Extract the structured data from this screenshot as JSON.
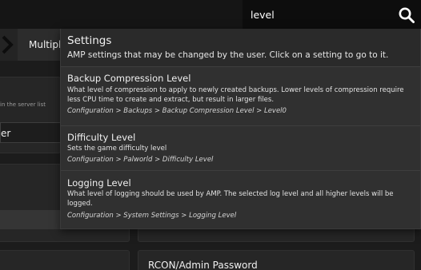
{
  "search": {
    "value": "level"
  },
  "background": {
    "tab_label": "Multiplic",
    "hint_text": "in the server list",
    "field_text": "er",
    "rcon_label": "RCON/Admin Password"
  },
  "dropdown": {
    "title": "Settings",
    "subtitle": "AMP settings that may be changed by the user. Click on a setting to go to it.",
    "items": [
      {
        "title": "Backup Compression Level",
        "description": "What level of compression to apply to newly created backups. Lower levels of compression require less CPU time to create and extract, but result in larger files.",
        "path": "Configuration > Backups > Backup Compression Level > Level0"
      },
      {
        "title": "Difficulty Level",
        "description": "Sets the game difficulty level",
        "path": "Configuration > Palworld > Difficulty Level"
      },
      {
        "title": "Logging Level",
        "description": "What level of logging should be used by AMP. The selected log level and all higher levels will be logged.",
        "path": "Configuration > System Settings > Logging Level"
      }
    ]
  }
}
